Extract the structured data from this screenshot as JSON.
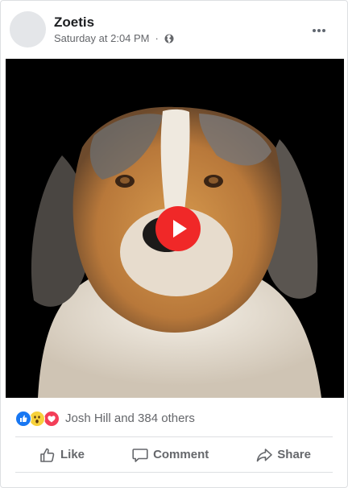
{
  "post": {
    "page_name": "Zoetis",
    "timestamp": "Saturday at 2:04 PM",
    "separator": "·",
    "privacy_icon": "globe-icon",
    "more_icon": "more-horizontal-icon"
  },
  "media": {
    "type": "video",
    "play_icon": "play-icon"
  },
  "reactions": {
    "icons": [
      "like-reaction-icon",
      "wow-reaction-icon",
      "love-reaction-icon"
    ],
    "summary": "Josh Hill and 384 others"
  },
  "actions": {
    "like_label": "Like",
    "comment_label": "Comment",
    "share_label": "Share"
  },
  "colors": {
    "primary_text": "#1c1e21",
    "secondary_text": "#65676b",
    "divider": "#dddfe2",
    "play_button": "#f02828",
    "like_blue": "#1877f2",
    "love_red": "#f33e58",
    "wow_yellow": "#f7d13b"
  }
}
